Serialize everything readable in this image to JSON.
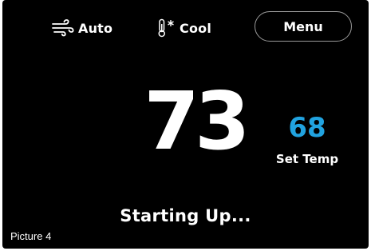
{
  "fan": {
    "icon": "fan-wind-icon",
    "label": "Auto"
  },
  "system": {
    "icon": "thermometer-snowflake-icon",
    "label": "Cool"
  },
  "menu": {
    "label": "Menu"
  },
  "temperature": {
    "current": "73",
    "set_value": "68",
    "set_label": "Set Temp"
  },
  "status": {
    "text": "Starting Up..."
  },
  "caption": {
    "text": "Picture 4"
  },
  "colors": {
    "background": "#000000",
    "text": "#ffffff",
    "set_temp_accent": "#21a3e0",
    "menu_border": "#9a9a9a"
  }
}
